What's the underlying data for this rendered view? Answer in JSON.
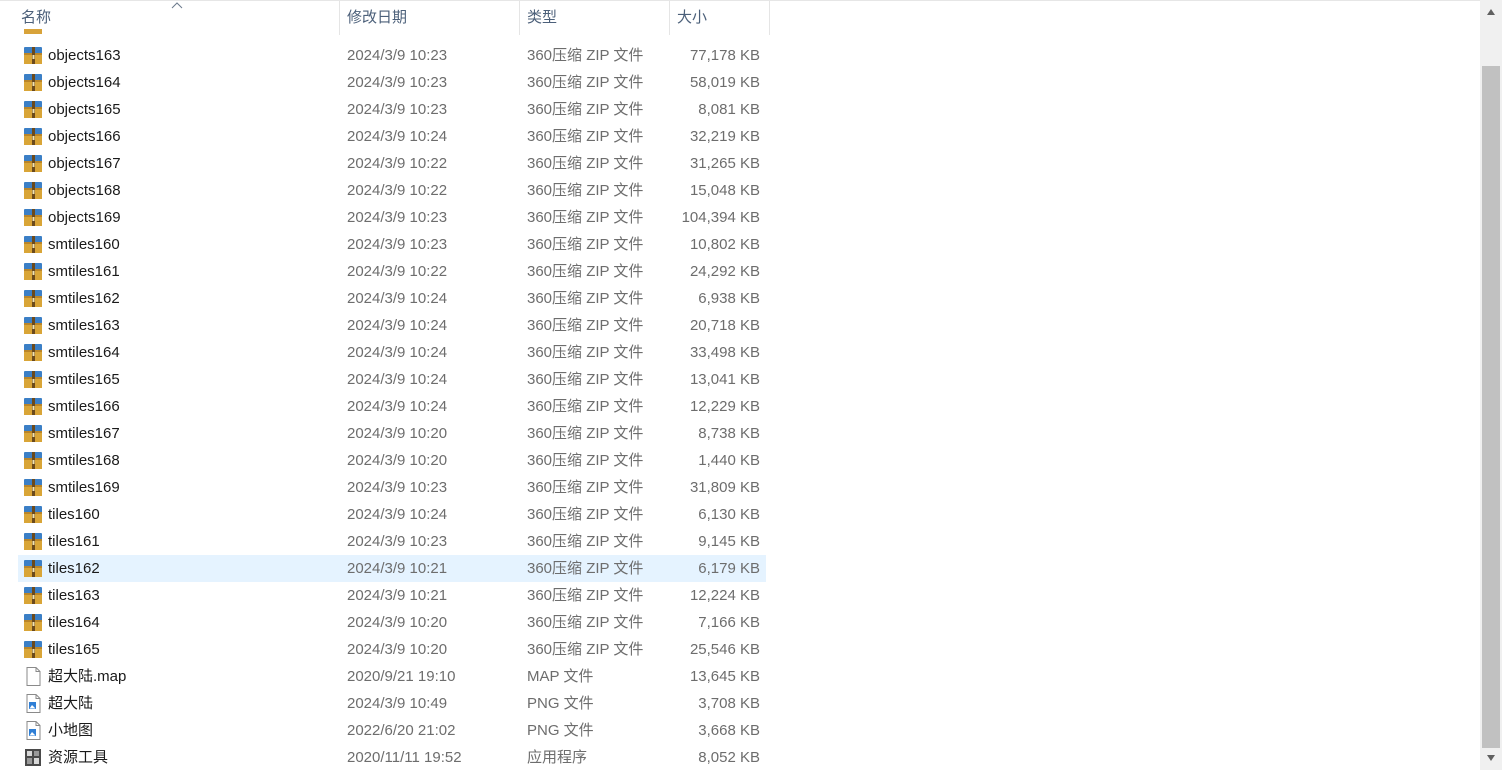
{
  "columns": {
    "name": "名称",
    "date": "修改日期",
    "type": "类型",
    "size": "大小"
  },
  "files": [
    {
      "name": "objects163",
      "date": "2024/3/9 10:23",
      "type": "360压缩 ZIP 文件",
      "size": "77,178 KB",
      "icon": "zip-archive-icon"
    },
    {
      "name": "objects164",
      "date": "2024/3/9 10:23",
      "type": "360压缩 ZIP 文件",
      "size": "58,019 KB",
      "icon": "zip-archive-icon"
    },
    {
      "name": "objects165",
      "date": "2024/3/9 10:23",
      "type": "360压缩 ZIP 文件",
      "size": "8,081 KB",
      "icon": "zip-archive-icon"
    },
    {
      "name": "objects166",
      "date": "2024/3/9 10:24",
      "type": "360压缩 ZIP 文件",
      "size": "32,219 KB",
      "icon": "zip-archive-icon"
    },
    {
      "name": "objects167",
      "date": "2024/3/9 10:22",
      "type": "360压缩 ZIP 文件",
      "size": "31,265 KB",
      "icon": "zip-archive-icon"
    },
    {
      "name": "objects168",
      "date": "2024/3/9 10:22",
      "type": "360压缩 ZIP 文件",
      "size": "15,048 KB",
      "icon": "zip-archive-icon"
    },
    {
      "name": "objects169",
      "date": "2024/3/9 10:23",
      "type": "360压缩 ZIP 文件",
      "size": "104,394 KB",
      "icon": "zip-archive-icon"
    },
    {
      "name": "smtiles160",
      "date": "2024/3/9 10:23",
      "type": "360压缩 ZIP 文件",
      "size": "10,802 KB",
      "icon": "zip-archive-icon"
    },
    {
      "name": "smtiles161",
      "date": "2024/3/9 10:22",
      "type": "360压缩 ZIP 文件",
      "size": "24,292 KB",
      "icon": "zip-archive-icon"
    },
    {
      "name": "smtiles162",
      "date": "2024/3/9 10:24",
      "type": "360压缩 ZIP 文件",
      "size": "6,938 KB",
      "icon": "zip-archive-icon"
    },
    {
      "name": "smtiles163",
      "date": "2024/3/9 10:24",
      "type": "360压缩 ZIP 文件",
      "size": "20,718 KB",
      "icon": "zip-archive-icon"
    },
    {
      "name": "smtiles164",
      "date": "2024/3/9 10:24",
      "type": "360压缩 ZIP 文件",
      "size": "33,498 KB",
      "icon": "zip-archive-icon"
    },
    {
      "name": "smtiles165",
      "date": "2024/3/9 10:24",
      "type": "360压缩 ZIP 文件",
      "size": "13,041 KB",
      "icon": "zip-archive-icon"
    },
    {
      "name": "smtiles166",
      "date": "2024/3/9 10:24",
      "type": "360压缩 ZIP 文件",
      "size": "12,229 KB",
      "icon": "zip-archive-icon"
    },
    {
      "name": "smtiles167",
      "date": "2024/3/9 10:20",
      "type": "360压缩 ZIP 文件",
      "size": "8,738 KB",
      "icon": "zip-archive-icon"
    },
    {
      "name": "smtiles168",
      "date": "2024/3/9 10:20",
      "type": "360压缩 ZIP 文件",
      "size": "1,440 KB",
      "icon": "zip-archive-icon"
    },
    {
      "name": "smtiles169",
      "date": "2024/3/9 10:23",
      "type": "360压缩 ZIP 文件",
      "size": "31,809 KB",
      "icon": "zip-archive-icon"
    },
    {
      "name": "tiles160",
      "date": "2024/3/9 10:24",
      "type": "360压缩 ZIP 文件",
      "size": "6,130 KB",
      "icon": "zip-archive-icon"
    },
    {
      "name": "tiles161",
      "date": "2024/3/9 10:23",
      "type": "360压缩 ZIP 文件",
      "size": "9,145 KB",
      "icon": "zip-archive-icon"
    },
    {
      "name": "tiles162",
      "date": "2024/3/9 10:21",
      "type": "360压缩 ZIP 文件",
      "size": "6,179 KB",
      "icon": "zip-archive-icon",
      "hovered": true
    },
    {
      "name": "tiles163",
      "date": "2024/3/9 10:21",
      "type": "360压缩 ZIP 文件",
      "size": "12,224 KB",
      "icon": "zip-archive-icon"
    },
    {
      "name": "tiles164",
      "date": "2024/3/9 10:20",
      "type": "360压缩 ZIP 文件",
      "size": "7,166 KB",
      "icon": "zip-archive-icon"
    },
    {
      "name": "tiles165",
      "date": "2024/3/9 10:20",
      "type": "360压缩 ZIP 文件",
      "size": "25,546 KB",
      "icon": "zip-archive-icon"
    },
    {
      "name": "超大陆.map",
      "date": "2020/9/21 19:10",
      "type": "MAP 文件",
      "size": "13,645 KB",
      "icon": "blank-file-icon"
    },
    {
      "name": "超大陆",
      "date": "2024/3/9 10:49",
      "type": "PNG 文件",
      "size": "3,708 KB",
      "icon": "image-file-icon"
    },
    {
      "name": "小地图",
      "date": "2022/6/20 21:02",
      "type": "PNG 文件",
      "size": "3,668 KB",
      "icon": "image-file-icon"
    },
    {
      "name": "资源工具",
      "date": "2020/11/11 19:52",
      "type": "应用程序",
      "size": "8,052 KB",
      "icon": "application-icon"
    }
  ],
  "colors": {
    "header_text": "#4c607a",
    "hover_row": "#e5f3ff",
    "secondary_text": "#6d6d6d",
    "scrollbar_thumb": "#c1c1c1"
  }
}
